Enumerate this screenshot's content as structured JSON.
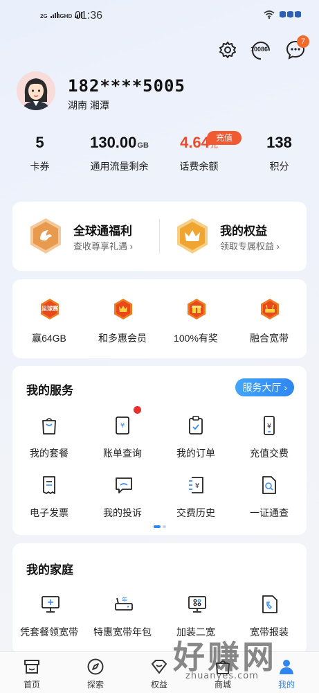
{
  "status_bar": {
    "network1": "2G",
    "network2": "4GHD",
    "time": "01:36"
  },
  "header": {
    "settings_icon": "gear-icon",
    "hotline_label": "10086",
    "messages_badge": "7"
  },
  "profile": {
    "phone": "182****5005",
    "location": "湖南  湘潭"
  },
  "stats": [
    {
      "value": "5",
      "unit": "",
      "label": "卡券"
    },
    {
      "value": "130.00",
      "unit": "GB",
      "label": "通用流量剩余"
    },
    {
      "value": "4.64",
      "unit": "元",
      "label": "话费余额",
      "tag": "充值"
    },
    {
      "value": "138",
      "unit": "",
      "label": "积分"
    }
  ],
  "benefits": [
    {
      "title": "全球通福利",
      "subtitle": "查收尊享礼遇 ›"
    },
    {
      "title": "我的权益",
      "subtitle": "领取专属权益 ›"
    }
  ],
  "promos": [
    {
      "label": "赢64GB",
      "icon_text": "足球赛"
    },
    {
      "label": "和多惠会员"
    },
    {
      "label": "100%有奖"
    },
    {
      "label": "融合宽带"
    }
  ],
  "services": {
    "title": "我的服务",
    "hall_button": "服务大厅 ›",
    "items": [
      {
        "label": "我的套餐"
      },
      {
        "label": "账单查询"
      },
      {
        "label": "我的订单"
      },
      {
        "label": "充值交费"
      },
      {
        "label": "电子发票"
      },
      {
        "label": "我的投诉"
      },
      {
        "label": "交费历史"
      },
      {
        "label": "一证通查"
      }
    ]
  },
  "family": {
    "title": "我的家庭",
    "items": [
      {
        "label": "凭套餐领宽带"
      },
      {
        "label": "特惠宽带年包"
      },
      {
        "label": "加装二宽"
      },
      {
        "label": "宽带报装"
      }
    ]
  },
  "bottom_nav": [
    {
      "label": "首页"
    },
    {
      "label": "探索"
    },
    {
      "label": "权益"
    },
    {
      "label": "商城"
    },
    {
      "label": "我的",
      "active": true
    }
  ],
  "watermark": {
    "big": "好赚网",
    "small": "zhuanyes.com"
  },
  "colors": {
    "accent_blue": "#2f86f0",
    "recharge_red": "#ec4a2a",
    "badge_orange": "#f26b2d"
  }
}
